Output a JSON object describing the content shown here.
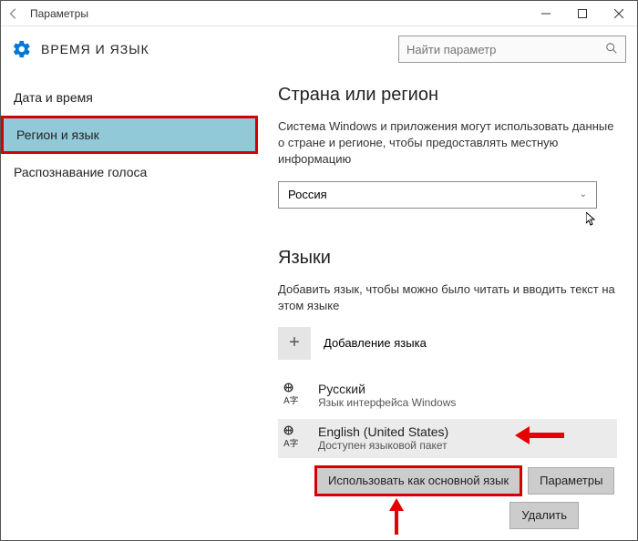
{
  "window": {
    "title": "Параметры"
  },
  "header": {
    "heading": "ВРЕМЯ И ЯЗЫК",
    "search_placeholder": "Найти параметр"
  },
  "sidebar": {
    "items": [
      {
        "label": "Дата и время"
      },
      {
        "label": "Регион и язык"
      },
      {
        "label": "Распознавание голоса"
      }
    ]
  },
  "region": {
    "title": "Страна или регион",
    "desc": "Система Windows и приложения могут использовать данные о стране и регионе, чтобы предоставлять местную информацию",
    "selected": "Россия"
  },
  "languages": {
    "title": "Языки",
    "desc": "Добавить язык, чтобы можно было читать и вводить текст на этом языке",
    "add_label": "Добавление языка",
    "items": [
      {
        "name": "Русский",
        "sub": "Язык интерфейса Windows"
      },
      {
        "name": "English (United States)",
        "sub": "Доступен языковой пакет"
      }
    ],
    "buttons": {
      "set_default": "Использовать как основной язык",
      "options": "Параметры",
      "remove": "Удалить"
    }
  }
}
